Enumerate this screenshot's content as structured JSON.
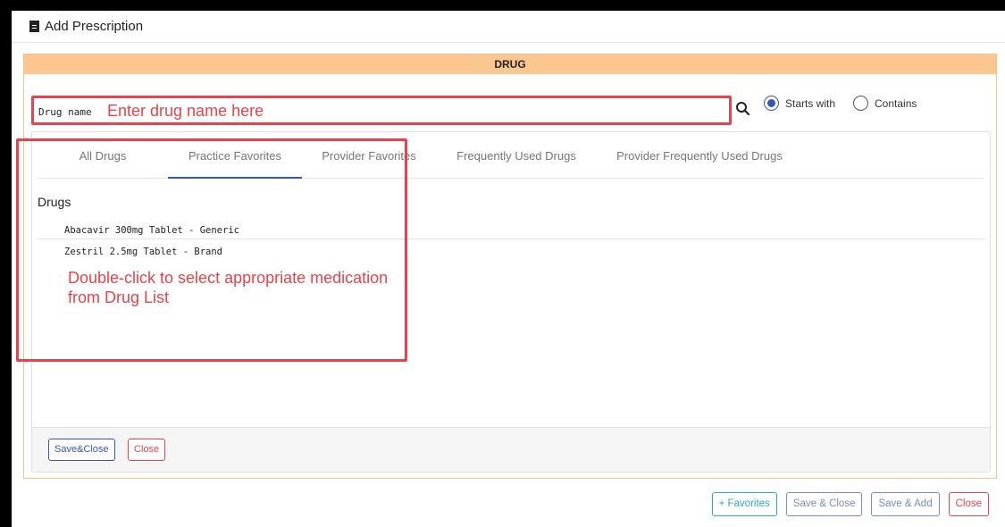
{
  "dialog": {
    "title": "Add Prescription"
  },
  "panel": {
    "header": "DRUG"
  },
  "search": {
    "label": "Drug name",
    "placeholder": "Enter drug name here",
    "options": [
      {
        "label": "Starts with",
        "checked": true
      },
      {
        "label": "Contains",
        "checked": false
      }
    ]
  },
  "tabs": [
    {
      "label": "All Drugs",
      "active": false
    },
    {
      "label": "Practice Favorites",
      "active": true
    },
    {
      "label": "Provider Favorites",
      "active": false
    },
    {
      "label": "Frequently Used Drugs",
      "active": false
    },
    {
      "label": "Provider Frequently Used Drugs",
      "active": false
    }
  ],
  "drugs": {
    "header": "Drugs",
    "items": [
      "Abacavir 300mg Tablet - Generic",
      "Zestril 2.5mg Tablet - Brand"
    ]
  },
  "annotation": "Double-click to select appropriate medication from Drug List",
  "inner_footer": {
    "save_close": "Save&Close",
    "close": "Close"
  },
  "footer": {
    "favorites": "+ Favorites",
    "save_close": "Save & Close",
    "save_add": "Save & Add",
    "close": "Close"
  },
  "colors": {
    "accent": "#3a53b8",
    "annotation": "#e8434b",
    "panel_header": "#fbc68f"
  }
}
